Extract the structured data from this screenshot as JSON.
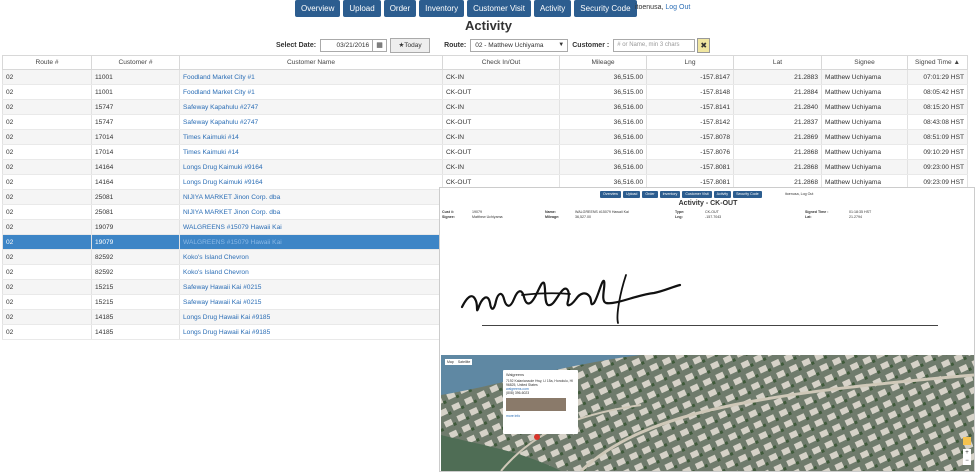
{
  "nav": [
    "Overview",
    "Upload",
    "Order",
    "Inventory",
    "Customer Visit",
    "Activity",
    "Security Code"
  ],
  "user": {
    "name": "itoenusa,",
    "logout": "Log Out"
  },
  "page_title": "Activity",
  "filters": {
    "date_label": "Select Date:",
    "date_value": "03/21/2016",
    "today_label": "★Today",
    "route_label": "Route:",
    "route_value": "02 - Matthew Uchiyama",
    "customer_label": "Customer :",
    "customer_placeholder": "# or Name, min 3 chars",
    "clear_label": "✖"
  },
  "table": {
    "headers": [
      "Route #",
      "Customer #",
      "Customer Name",
      "Check In/Out",
      "Mileage",
      "Lng",
      "Lat",
      "Signee",
      "Signed Time ▲"
    ],
    "rows": [
      [
        "02",
        "11001",
        "Foodland Market City #1",
        "CK-IN",
        "36,515.00",
        "-157.8147",
        "21.2883",
        "Matthew Uchiyama",
        "07:01:29 HST"
      ],
      [
        "02",
        "11001",
        "Foodland Market City #1",
        "CK-OUT",
        "36,515.00",
        "-157.8148",
        "21.2884",
        "Matthew Uchiyama",
        "08:05:42 HST"
      ],
      [
        "02",
        "15747",
        "Safeway Kapahulu #2747",
        "CK-IN",
        "36,516.00",
        "-157.8141",
        "21.2840",
        "Matthew Uchiyama",
        "08:15:20 HST"
      ],
      [
        "02",
        "15747",
        "Safeway Kapahulu #2747",
        "CK-OUT",
        "36,516.00",
        "-157.8142",
        "21.2837",
        "Matthew Uchiyama",
        "08:43:08 HST"
      ],
      [
        "02",
        "17014",
        "Times Kaimuki #14",
        "CK-IN",
        "36,516.00",
        "-157.8078",
        "21.2869",
        "Matthew Uchiyama",
        "08:51:09 HST"
      ],
      [
        "02",
        "17014",
        "Times Kaimuki #14",
        "CK-OUT",
        "36,516.00",
        "-157.8076",
        "21.2868",
        "Matthew Uchiyama",
        "09:10:29 HST"
      ],
      [
        "02",
        "14164",
        "Longs Drug Kaimuki #9164",
        "CK-IN",
        "36,516.00",
        "-157.8081",
        "21.2868",
        "Matthew Uchiyama",
        "09:23:00 HST"
      ],
      [
        "02",
        "14164",
        "Longs Drug Kaimuki #9164",
        "CK-OUT",
        "36,516.00",
        "-157.8081",
        "21.2868",
        "Matthew Uchiyama",
        "09:23:09 HST"
      ],
      [
        "02",
        "25081",
        "NIJIYA MARKET Jinon Corp. dba",
        "",
        "",
        "",
        "",
        "",
        ""
      ],
      [
        "02",
        "25081",
        "NIJIYA MARKET Jinon Corp. dba",
        "",
        "",
        "",
        "",
        "",
        ""
      ],
      [
        "02",
        "19079",
        "WALGREENS #15079 Hawaii Kai",
        "",
        "",
        "",
        "",
        "",
        ""
      ],
      [
        "02",
        "19079",
        "WALGREENS #15079 Hawaii Kai",
        "",
        "",
        "",
        "",
        "",
        ""
      ],
      [
        "02",
        "82592",
        "Koko's Island Chevron",
        "",
        "",
        "",
        "",
        "",
        ""
      ],
      [
        "02",
        "82592",
        "Koko's Island Chevron",
        "",
        "",
        "",
        "",
        "",
        ""
      ],
      [
        "02",
        "15215",
        "Safeway Hawaii Kai #0215",
        "",
        "",
        "",
        "",
        "",
        ""
      ],
      [
        "02",
        "15215",
        "Safeway Hawaii Kai #0215",
        "",
        "",
        "",
        "",
        "",
        ""
      ],
      [
        "02",
        "14185",
        "Longs Drug Hawaii Kai #9185",
        "",
        "",
        "",
        "",
        "",
        ""
      ],
      [
        "02",
        "14185",
        "Longs Drug Hawaii Kai #9185",
        "",
        "",
        "",
        "",
        "",
        ""
      ]
    ],
    "selected_row": 11
  },
  "popup": {
    "nav": [
      "Overview",
      "Upload",
      "Order",
      "Inventory",
      "Customer Visit",
      "Activity",
      "Security Code"
    ],
    "user": "itoenusa, Log Out",
    "title": "Activity - CK-OUT",
    "info": {
      "row1": [
        "Cust #:",
        "19079",
        "Name:",
        "WALGREENS #15079 Hawaii Kai",
        "Type:",
        "CK-OUT",
        "Signed Time :",
        "01:18:35 HST"
      ],
      "row2": [
        "Signee:",
        "Matthew Uchiyama",
        "Mileage:",
        "36,527.00",
        "Lng:",
        "-157.7043",
        "Lat:",
        "21.2794"
      ]
    },
    "map": {
      "tabs": [
        "Map",
        "Satellite"
      ],
      "place": "Walgreens",
      "address": "7192 Kalanianaole Hwy, Ll 15a, Honolulu, HI 96825, United States",
      "website": "walgreens.com",
      "phone": "(808) 396-6023",
      "more": "more info"
    }
  }
}
